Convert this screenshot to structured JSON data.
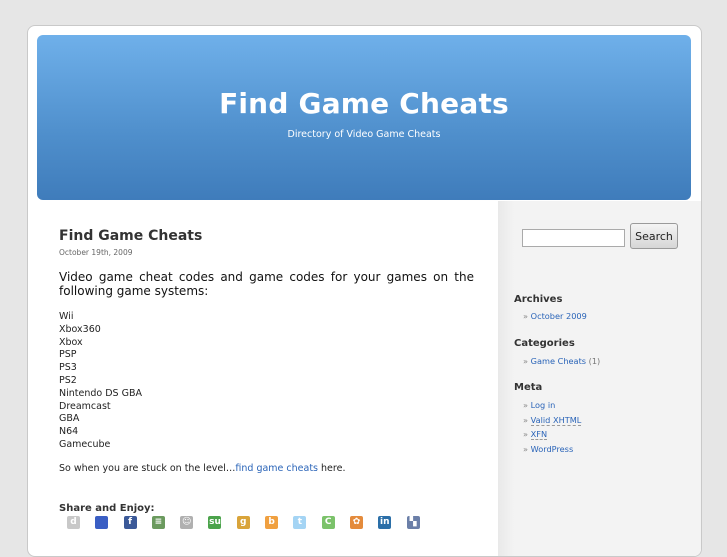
{
  "header": {
    "title": "Find Game Cheats",
    "description": "Directory of Video Game Cheats"
  },
  "post": {
    "title": "Find Game Cheats",
    "date": "October 19th, 2009",
    "intro": "Video game cheat codes and game codes for your games on the following game systems:",
    "systems": [
      "Wii",
      "Xbox360",
      "Xbox",
      "PSP",
      "PS3",
      "PS2",
      "Nintendo DS GBA",
      "Dreamcast",
      "GBA",
      "N64",
      "Gamecube"
    ],
    "stuck_prefix": "So when you are stuck on the level…",
    "stuck_link": "find game cheats",
    "stuck_suffix": " here.",
    "share_label": "Share and Enjoy:"
  },
  "share_icons": [
    {
      "name": "digg-icon",
      "glyph": "d",
      "color": "#c8c8c8"
    },
    {
      "name": "delicious-icon",
      "glyph": "",
      "color": "#3a5ec4"
    },
    {
      "name": "facebook-icon",
      "glyph": "f",
      "color": "#3b5998"
    },
    {
      "name": "google-bookmarks-icon",
      "glyph": "≡",
      "color": "#6b9a5e"
    },
    {
      "name": "reddit-icon",
      "glyph": "☺",
      "color": "#b0b0b0"
    },
    {
      "name": "stumbleupon-icon",
      "glyph": "su",
      "color": "#4ba34b"
    },
    {
      "name": "google-buzz-icon",
      "glyph": "g",
      "color": "#d9a43a"
    },
    {
      "name": "blogger-icon",
      "glyph": "b",
      "color": "#f0a040"
    },
    {
      "name": "twitter-icon",
      "glyph": "t",
      "color": "#a4d4f4"
    },
    {
      "name": "technorati-icon",
      "glyph": "C",
      "color": "#7bc26a"
    },
    {
      "name": "live-icon",
      "glyph": "✿",
      "color": "#e48b3c"
    },
    {
      "name": "linkedin-icon",
      "glyph": "in",
      "color": "#2b6fa8"
    },
    {
      "name": "mixx-icon",
      "glyph": "▚",
      "color": "#6b7fa8"
    }
  ],
  "sidebar": {
    "search_button": "Search",
    "search_placeholder": "",
    "archives_title": "Archives",
    "archives": [
      "October 2009"
    ],
    "categories_title": "Categories",
    "categories": [
      {
        "label": "Game Cheats",
        "count": "(1)"
      }
    ],
    "meta_title": "Meta",
    "meta": [
      "Log in",
      "Valid XHTML",
      "XFN",
      "WordPress"
    ]
  }
}
